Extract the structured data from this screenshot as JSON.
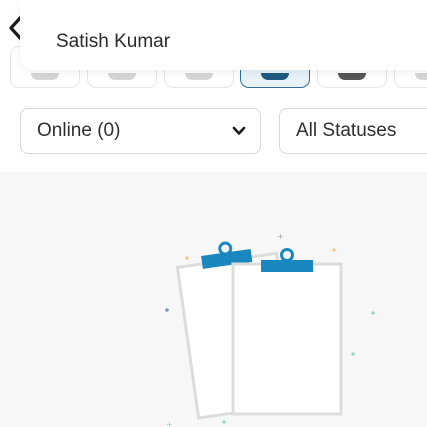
{
  "header": {
    "title": "Satish Kumar",
    "back_icon": "chevron-left-icon"
  },
  "filters": {
    "online_select": {
      "selected": "Online (0)",
      "icon": "chevron-down-icon"
    },
    "status_select": {
      "selected": "All Statuses"
    }
  },
  "tabs": {
    "active_index": 3,
    "count": 6
  },
  "empty_state": {
    "illustration": "clipboards-icon",
    "accent_color": "#1a88bf"
  },
  "colors": {
    "active_tab_border": "#2f6f96",
    "active_tab_bg": "#e8f2f9",
    "content_bg": "#f7f7f7"
  }
}
